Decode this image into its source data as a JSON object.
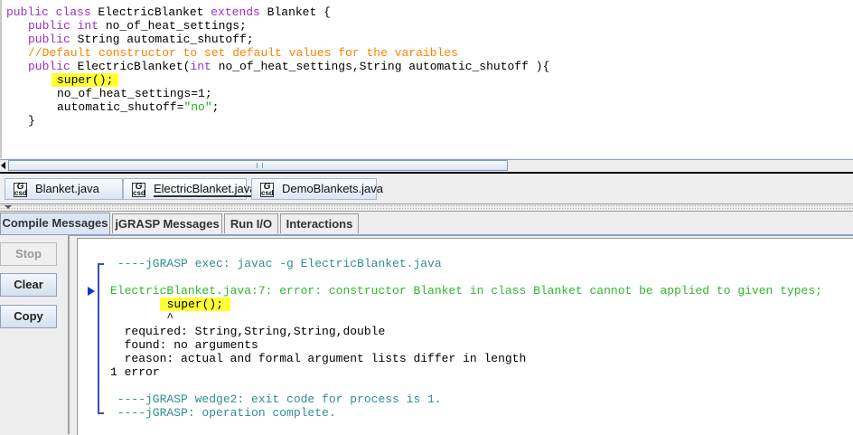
{
  "editor": {
    "lines": [
      {
        "indent": 0,
        "segments": [
          {
            "t": "public class ",
            "k": "kw"
          },
          {
            "t": "ElectricBlanket ",
            "k": "pl"
          },
          {
            "t": "extends ",
            "k": "kw"
          },
          {
            "t": "Blanket {",
            "k": "pl"
          }
        ]
      },
      {
        "indent": 3,
        "segments": [
          {
            "t": "public int ",
            "k": "kw"
          },
          {
            "t": "no_of_heat_settings;",
            "k": "pl"
          }
        ]
      },
      {
        "indent": 3,
        "segments": [
          {
            "t": "public ",
            "k": "kw"
          },
          {
            "t": "String automatic_shutoff;",
            "k": "pl"
          }
        ]
      },
      {
        "indent": 3,
        "segments": [
          {
            "t": "//Default constructor to set default values for the varaibles",
            "k": "cm"
          }
        ]
      },
      {
        "indent": 3,
        "segments": [
          {
            "t": "public ",
            "k": "kw"
          },
          {
            "t": "ElectricBlanket(",
            "k": "pl"
          },
          {
            "t": "int ",
            "k": "kw"
          },
          {
            "t": "no_of_heat_settings,String automatic_shutoff ){",
            "k": "pl"
          }
        ]
      },
      {
        "indent": 7,
        "segments": [
          {
            "t": "super();",
            "k": "pl",
            "hl": true
          }
        ]
      },
      {
        "indent": 7,
        "segments": [
          {
            "t": "no_of_heat_settings=1;",
            "k": "pl"
          }
        ]
      },
      {
        "indent": 7,
        "segments": [
          {
            "t": "automatic_shutoff=",
            "k": "pl"
          },
          {
            "t": "\"no\"",
            "k": "st"
          },
          {
            "t": ";",
            "k": "pl"
          }
        ]
      },
      {
        "indent": 3,
        "segments": [
          {
            "t": "}",
            "k": "pl"
          }
        ]
      }
    ]
  },
  "file_tabs": [
    {
      "label": "Blanket.java",
      "active": false
    },
    {
      "label": "ElectricBlanket.java",
      "active": true
    },
    {
      "label": "DemoBlankets.java",
      "active": false
    }
  ],
  "file_tab_icon": "G\nCSD",
  "message_tabs": [
    {
      "label": "Compile Messages",
      "active": true
    },
    {
      "label": "jGRASP Messages",
      "active": false
    },
    {
      "label": "Run I/O",
      "active": false
    },
    {
      "label": "Interactions",
      "active": false
    }
  ],
  "buttons": {
    "stop": "Stop",
    "clear": "Clear",
    "copy": "Copy"
  },
  "output": {
    "lines": [
      {
        "text": " ----jGRASP exec: javac -g ElectricBlanket.java",
        "color": "teal"
      },
      {
        "text": "",
        "color": "blk"
      },
      {
        "text": "ElectricBlanket.java:7: error: constructor Blanket in class Blanket cannot be applied to given types;",
        "color": "green"
      },
      {
        "text": "        super();",
        "color": "blk",
        "hl": true
      },
      {
        "text": "        ^",
        "color": "blk"
      },
      {
        "text": "  required: String,String,String,double",
        "color": "blk"
      },
      {
        "text": "  found: no arguments",
        "color": "blk"
      },
      {
        "text": "  reason: actual and formal argument lists differ in length",
        "color": "blk"
      },
      {
        "text": "1 error",
        "color": "blk"
      },
      {
        "text": "",
        "color": "blk"
      },
      {
        "text": " ----jGRASP wedge2: exit code for process is 1.",
        "color": "teal"
      },
      {
        "text": " ----jGRASP: operation complete.",
        "color": "teal"
      }
    ]
  },
  "colors": {
    "keyword": "#9b30c8",
    "comment": "#ff8000",
    "string": "#22aa22",
    "highlight": "#ffff33",
    "exec_message": "#2f8f8f",
    "error_message": "#2fb82f"
  }
}
